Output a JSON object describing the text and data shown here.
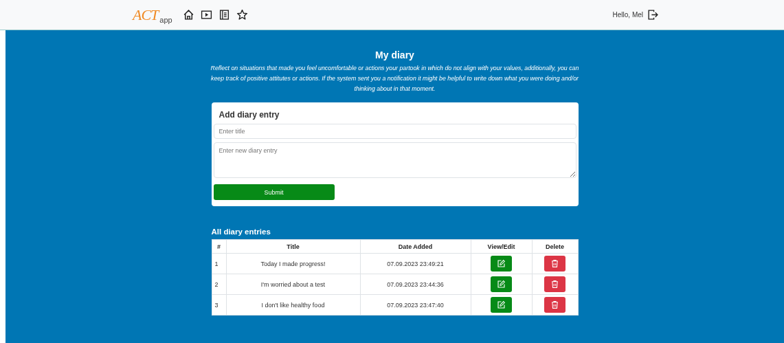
{
  "navbar": {
    "logo": {
      "main": "ACT",
      "sub": "app"
    },
    "greeting": "Hello, Mel"
  },
  "header": {
    "title": "My diary",
    "description": "Reflect on situations that made you feel uncomfortable or actions your partook in which do not align with your values, additionally, you can keep track of positive attitutes or actions. If the system sent you a notification it might be helpful to write down what you were doing and/or thinking about in that moment."
  },
  "form": {
    "title": "Add diary entry",
    "title_field": {
      "placeholder": "Enter title"
    },
    "entry_field": {
      "placeholder": "Enter new diary entry"
    },
    "submit": "Submit"
  },
  "table": {
    "title": "All diary entries",
    "columns": [
      "#",
      "Title",
      "Date Added",
      "View/Edit",
      "Delete"
    ],
    "rows": [
      {
        "number": "1",
        "title": "Today I made progress!",
        "date": "07.09.2023 23:49:21"
      },
      {
        "number": "2",
        "title": "I'm worried about a test",
        "date": "07.09.2023 23:44:36"
      },
      {
        "number": "3",
        "title": "I don't like healthy food",
        "date": "07.09.2023 23:47:40"
      }
    ]
  }
}
